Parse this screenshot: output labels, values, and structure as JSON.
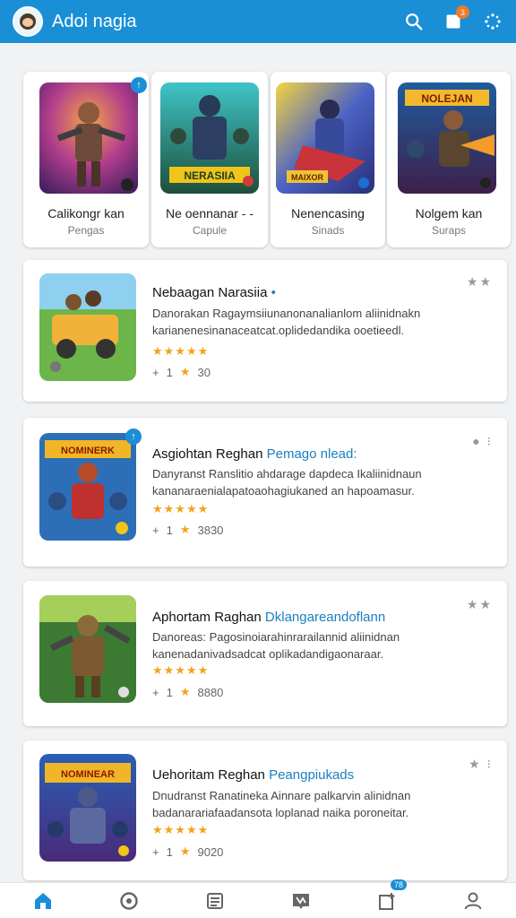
{
  "header": {
    "title": "Adoi nagia",
    "notification_count": "3"
  },
  "featured": [
    {
      "title": "Calikongr kan",
      "sub": "Pengas"
    },
    {
      "title": "Ne oennanar - -",
      "sub": "Capule"
    },
    {
      "title": "Nenencasing",
      "sub": "Sinads"
    },
    {
      "title": "Nolgem kan",
      "sub": "Suraps"
    }
  ],
  "featured_art_text": {
    "card2": "NERASIIA",
    "card3": "MAIXOR",
    "card4": "NOLEJAN"
  },
  "list": [
    {
      "name": "Nebaagan Narasiia",
      "tag": "•",
      "desc": "Danorakan Ragaymsiiunanonanalianlom aliinidnakn karianenesinanaceatcat.oplidedandika ooetieedl.",
      "stars": "★★★★★",
      "count": "1",
      "rating": "30",
      "art_text": ""
    },
    {
      "name": "Asgiohtan Reghan",
      "tag": "Pemago nlead:",
      "desc": "Danyranst Ranslitio ahdarage dapdeca Ikaliinidnaun kananaraenialapatoaohagiukaned an hapoamasur.",
      "stars": "★★★★★",
      "count": "1",
      "rating": "3830",
      "art_text": "NOMINERK"
    },
    {
      "name": "Aphortam Raghan",
      "tag": "Dklangareandoflann",
      "desc": "Danoreas: Pagosinoiarahinrarailannid aliinidnan kanenadanivadsadcat oplikadandigaonaraar.",
      "stars": "★★★★★",
      "count": "1",
      "rating": "8880",
      "art_text": ""
    },
    {
      "name": "Uehoritam Reghan",
      "tag": "Peangpiukads",
      "desc": "Dnudranst Ranatineka Ainnare palkarvin alinidnan badanarariafaadansota loplanad naika poroneitar.",
      "stars": "★★★★★",
      "count": "1",
      "rating": "9020",
      "art_text": "NOMINEAR"
    }
  ],
  "bottom_nav": {
    "badge": "78"
  }
}
